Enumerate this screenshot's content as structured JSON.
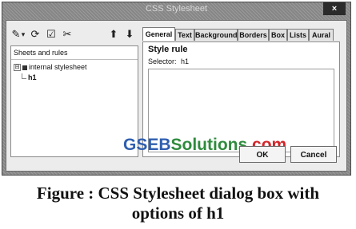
{
  "window": {
    "title": "CSS Stylesheet",
    "close_glyph": "×"
  },
  "toolbar": {
    "icons": [
      {
        "name": "stylesheet-icon",
        "glyph": "✎"
      },
      {
        "name": "dropdown-icon",
        "glyph": "▾"
      },
      {
        "name": "add-rule-icon",
        "glyph": "⟳"
      },
      {
        "name": "edit-icon",
        "glyph": "☑"
      },
      {
        "name": "remove-icon",
        "glyph": "✂"
      },
      {
        "name": "move-up-icon",
        "glyph": "⬆"
      },
      {
        "name": "move-down-icon",
        "glyph": "⬇"
      }
    ]
  },
  "tree": {
    "header": "Sheets and rules",
    "root": {
      "expander": "⊟",
      "label": "internal stylesheet"
    },
    "child": {
      "label": "h1"
    }
  },
  "tabs": [
    "General",
    "Text",
    "Background",
    "Borders",
    "Box",
    "Lists",
    "Aural"
  ],
  "content": {
    "heading": "Style rule",
    "selector_label": "Selector:",
    "selector_value": "h1"
  },
  "buttons": {
    "ok": "OK",
    "cancel": "Cancel"
  },
  "watermark": {
    "part1": "GSEB",
    "part2": "Solutions",
    "part3": ".com"
  },
  "caption": {
    "line1": "Figure : CSS Stylesheet dialog box with",
    "line2": "options of h1"
  },
  "colors": {
    "watermark_blue": "#2f5fb0",
    "watermark_green": "#2e8b3d",
    "watermark_red": "#d4252a"
  }
}
